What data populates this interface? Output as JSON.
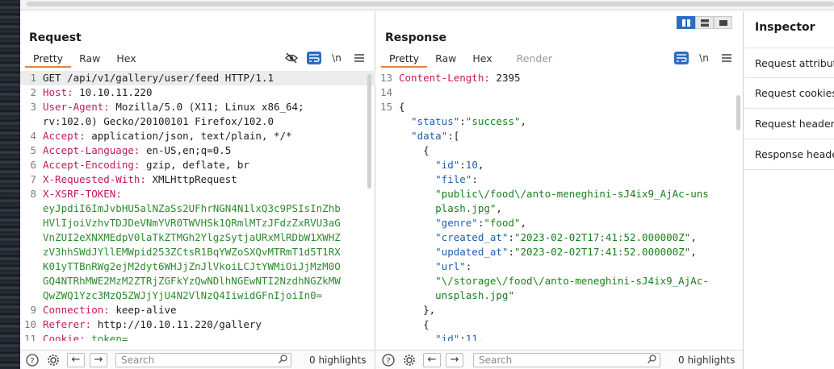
{
  "request": {
    "title": "Request",
    "tabs": [
      "Pretty",
      "Raw",
      "Hex"
    ],
    "lines": [
      {
        "n": "1",
        "parts": [
          {
            "t": "GET /api/v1/gallery/user/feed HTTP/1.1",
            "c": ""
          }
        ]
      },
      {
        "n": "2",
        "parts": [
          {
            "t": "Host: ",
            "c": "k"
          },
          {
            "t": "10.10.11.220",
            "c": ""
          }
        ]
      },
      {
        "n": "3",
        "parts": [
          {
            "t": "User-Agent: ",
            "c": "k"
          },
          {
            "t": "Mozilla/5.0 (X11; Linux x86_64;",
            "c": ""
          }
        ]
      },
      {
        "n": "",
        "parts": [
          {
            "t": "rv:102.0) Gecko/20100101 Firefox/102.0",
            "c": ""
          }
        ]
      },
      {
        "n": "4",
        "parts": [
          {
            "t": "Accept: ",
            "c": "k"
          },
          {
            "t": "application/json, text/plain, */*",
            "c": ""
          }
        ]
      },
      {
        "n": "5",
        "parts": [
          {
            "t": "Accept-Language: ",
            "c": "k"
          },
          {
            "t": "en-US,en;q=0.5",
            "c": ""
          }
        ]
      },
      {
        "n": "6",
        "parts": [
          {
            "t": "Accept-Encoding: ",
            "c": "k"
          },
          {
            "t": "gzip, deflate, br",
            "c": ""
          }
        ]
      },
      {
        "n": "7",
        "parts": [
          {
            "t": "X-Requested-With: ",
            "c": "k"
          },
          {
            "t": "XMLHttpRequest",
            "c": ""
          }
        ]
      },
      {
        "n": "8",
        "parts": [
          {
            "t": "X-XSRF-TOKEN:",
            "c": "k"
          }
        ]
      },
      {
        "n": "",
        "parts": [
          {
            "t": "eyJpdiI6ImJvbHU5alNZaSs2UFhrNGN4N1lxQ3c9PSIsInZhb",
            "c": "s"
          }
        ]
      },
      {
        "n": "",
        "parts": [
          {
            "t": "HVlIjoiVzhvTDJDeVNmYVR0TWVHSk1QRmlMTzJFdzZxRVU3aG",
            "c": "s"
          }
        ]
      },
      {
        "n": "",
        "parts": [
          {
            "t": "VnZUI2eXNXMEdpV0laTkZTMGh2YlgzSytjaURxMlRDbW1XWHZ",
            "c": "s"
          }
        ]
      },
      {
        "n": "",
        "parts": [
          {
            "t": "zV3hhSWdJYllEMWpid253ZCtsR1BqYWZoSXQvMTRmT1d5T1RX",
            "c": "s"
          }
        ]
      },
      {
        "n": "",
        "parts": [
          {
            "t": "K01yTTBnRWg2ejM2dyt6WHJjZnJlVkoiLCJtYWMiOiJjMzM0O",
            "c": "s"
          }
        ]
      },
      {
        "n": "",
        "parts": [
          {
            "t": "GQ4NTRhMWE2MzM2ZTRjZGFkYzQwNDlhNGEwNTI2NzdhNGZkMW",
            "c": "s"
          }
        ]
      },
      {
        "n": "",
        "parts": [
          {
            "t": "QwZWQ1Yzc3MzQ5ZWJjYjU4N2VlNzQ4IiwidGFnIjoiIn0=",
            "c": "s"
          }
        ]
      },
      {
        "n": "9",
        "parts": [
          {
            "t": "Connection: ",
            "c": "k"
          },
          {
            "t": "keep-alive",
            "c": ""
          }
        ]
      },
      {
        "n": "10",
        "parts": [
          {
            "t": "Referer: ",
            "c": "k"
          },
          {
            "t": "http://10.10.11.220/gallery",
            "c": ""
          }
        ]
      },
      {
        "n": "11",
        "parts": [
          {
            "t": "Cookie: ",
            "c": "k"
          },
          {
            "t": "token=",
            "c": "s"
          }
        ]
      }
    ],
    "search_placeholder": "Search",
    "highlights": "0 highlights"
  },
  "response": {
    "title": "Response",
    "tabs": [
      "Pretty",
      "Raw",
      "Hex",
      "Render"
    ],
    "lines": [
      {
        "n": "13",
        "parts": [
          {
            "t": "Content-Length: ",
            "c": "k"
          },
          {
            "t": "2395",
            "c": ""
          }
        ]
      },
      {
        "n": "14",
        "parts": [
          {
            "t": "",
            "c": ""
          }
        ]
      },
      {
        "n": "15",
        "parts": [
          {
            "t": "{",
            "c": ""
          }
        ]
      },
      {
        "n": "",
        "parts": [
          {
            "t": "  \"status\"",
            "c": "key"
          },
          {
            "t": ":",
            "c": ""
          },
          {
            "t": "\"success\"",
            "c": "str"
          },
          {
            "t": ",",
            "c": ""
          }
        ]
      },
      {
        "n": "",
        "parts": [
          {
            "t": "  \"data\"",
            "c": "key"
          },
          {
            "t": ":[",
            "c": ""
          }
        ]
      },
      {
        "n": "",
        "parts": [
          {
            "t": "    {",
            "c": ""
          }
        ]
      },
      {
        "n": "",
        "parts": [
          {
            "t": "      \"id\"",
            "c": "key"
          },
          {
            "t": ":",
            "c": ""
          },
          {
            "t": "10",
            "c": "num"
          },
          {
            "t": ",",
            "c": ""
          }
        ]
      },
      {
        "n": "",
        "parts": [
          {
            "t": "      \"file\"",
            "c": "key"
          },
          {
            "t": ":",
            "c": ""
          }
        ]
      },
      {
        "n": "",
        "parts": [
          {
            "t": "      \"public\\/food\\/anto-meneghini-sJ4ix9_AjAc-uns",
            "c": "str"
          }
        ]
      },
      {
        "n": "",
        "parts": [
          {
            "t": "      plash.jpg\"",
            "c": "str"
          },
          {
            "t": ",",
            "c": ""
          }
        ]
      },
      {
        "n": "",
        "parts": [
          {
            "t": "      \"genre\"",
            "c": "key"
          },
          {
            "t": ":",
            "c": ""
          },
          {
            "t": "\"food\"",
            "c": "str"
          },
          {
            "t": ",",
            "c": ""
          }
        ]
      },
      {
        "n": "",
        "parts": [
          {
            "t": "      \"created_at\"",
            "c": "key"
          },
          {
            "t": ":",
            "c": ""
          },
          {
            "t": "\"2023-02-02T17:41:52.000000Z\"",
            "c": "str"
          },
          {
            "t": ",",
            "c": ""
          }
        ]
      },
      {
        "n": "",
        "parts": [
          {
            "t": "      \"updated_at\"",
            "c": "key"
          },
          {
            "t": ":",
            "c": ""
          },
          {
            "t": "\"2023-02-02T17:41:52.000000Z\"",
            "c": "str"
          },
          {
            "t": ",",
            "c": ""
          }
        ]
      },
      {
        "n": "",
        "parts": [
          {
            "t": "      \"url\"",
            "c": "key"
          },
          {
            "t": ":",
            "c": ""
          }
        ]
      },
      {
        "n": "",
        "parts": [
          {
            "t": "      \"\\/storage\\/food\\/anto-meneghini-sJ4ix9_AjAc-",
            "c": "str"
          }
        ]
      },
      {
        "n": "",
        "parts": [
          {
            "t": "      unsplash.jpg\"",
            "c": "str"
          }
        ]
      },
      {
        "n": "",
        "parts": [
          {
            "t": "    },",
            "c": ""
          }
        ]
      },
      {
        "n": "",
        "parts": [
          {
            "t": "    {",
            "c": ""
          }
        ]
      },
      {
        "n": "",
        "parts": [
          {
            "t": "      \"id\"",
            "c": "key"
          },
          {
            "t": ":",
            "c": ""
          },
          {
            "t": "11",
            "c": "num"
          },
          {
            "t": ",",
            "c": ""
          }
        ]
      }
    ],
    "search_placeholder": "Search",
    "highlights": "0 highlights"
  },
  "inspector": {
    "title": "Inspector",
    "items": [
      "Request attributes",
      "Request cookies",
      "Request headers",
      "Response headers"
    ]
  },
  "icons": {
    "hide": "eye-slash-icon",
    "wrap": "wrap-icon",
    "newline": "\\n",
    "menu": "menu-icon",
    "help": "?",
    "settings": "gear-icon",
    "prev": "←",
    "next": "→"
  },
  "colors": {
    "accent_tab": "#e8813a",
    "selected_blue": "#2d6cc0",
    "header_key": "#c2185b",
    "json_key": "#1d5fb0",
    "json_string": "#1a7f1a"
  }
}
